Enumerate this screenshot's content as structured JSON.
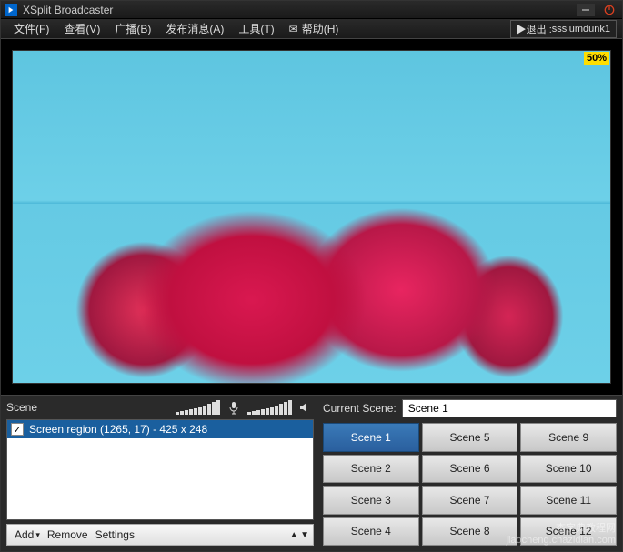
{
  "window": {
    "title": "XSplit Broadcaster"
  },
  "menu": {
    "file": "文件(F)",
    "view": "查看(V)",
    "broadcast": "广播(B)",
    "publish": "发布消息(A)",
    "tools": "工具(T)",
    "help": "帮助(H)",
    "exit_prefix": "▶退出 : ",
    "exit_user": "ssslumdunk1"
  },
  "preview": {
    "zoom": "50%"
  },
  "audio": {
    "scene_label": "Scene"
  },
  "sources": {
    "items": [
      {
        "checked": true,
        "label": "Screen region (1265, 17) - 425 x 248"
      }
    ]
  },
  "toolbar": {
    "add": "Add",
    "remove": "Remove",
    "settings": "Settings"
  },
  "current_scene": {
    "label": "Current Scene:",
    "value": "Scene 1"
  },
  "scenes": {
    "s1": "Scene 1",
    "s2": "Scene 2",
    "s3": "Scene 3",
    "s4": "Scene 4",
    "s5": "Scene 5",
    "s6": "Scene 6",
    "s7": "Scene 7",
    "s8": "Scene 8",
    "s9": "Scene 9",
    "s10": "Scene 10",
    "s11": "Scene 11",
    "s12": "Scene 12"
  },
  "watermark": {
    "line1": "杏字典教程网",
    "line2": "jiaocheng.chazidian.com"
  }
}
